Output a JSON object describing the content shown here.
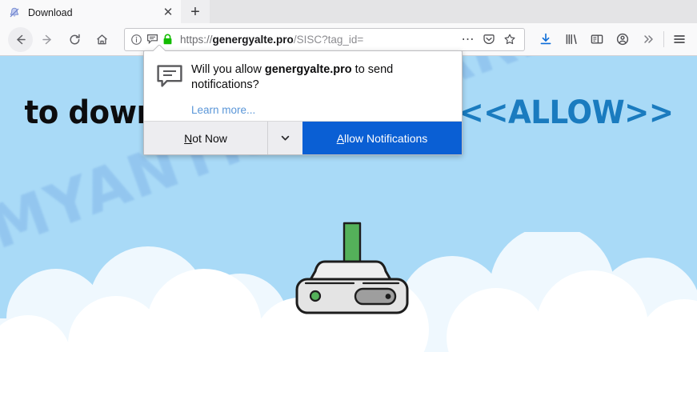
{
  "browser": {
    "tab": {
      "title": "Download",
      "favicon": "blocked-notification-icon",
      "close_label": "✕",
      "newtab_label": "+"
    },
    "nav": {
      "back": "←",
      "forward": "→",
      "reload": "↻",
      "home": "home-icon"
    },
    "urlbar": {
      "info_icon": "info-circle-icon",
      "permission_icon": "notification-bubble-icon",
      "lock_icon": "green-padlock-icon",
      "scheme": "https://",
      "domain": "genergyalte.pro",
      "path": "/SISC?tag_id=",
      "page_actions_label": "⋯",
      "pocket_icon": "pocket-icon",
      "bookmark_icon": "star-icon"
    },
    "toolbar_icons": [
      "downloads-icon",
      "library-icon",
      "sidebar-icon",
      "account-icon",
      "overflow-icon",
      "menu-icon"
    ]
  },
  "popup": {
    "icon": "speech-bubble-icon",
    "question_prefix": "Will you allow ",
    "question_domain": "genergyalte.pro",
    "question_suffix": " to send notifications?",
    "learn_more": "Learn more...",
    "not_now": "Not Now",
    "not_now_accesskey": "N",
    "dropdown_icon": "chevron-down-icon",
    "allow": "Allow Notifications",
    "allow_accesskey": "A"
  },
  "page": {
    "headline_main": "to download the file, click ",
    "headline_allow": "<<ALLOW>>",
    "watermark": "MYANTISPYWARE.COM",
    "illustration": "hard-drive-download-icon",
    "colors": {
      "sky": "#a9daf7",
      "allow_blue": "#1a7bbf",
      "button_blue": "#0a5fd4",
      "arrow_green": "#54b15a",
      "padlock_green": "#12bc00",
      "watermark_blue": "#7fb4e8"
    }
  }
}
